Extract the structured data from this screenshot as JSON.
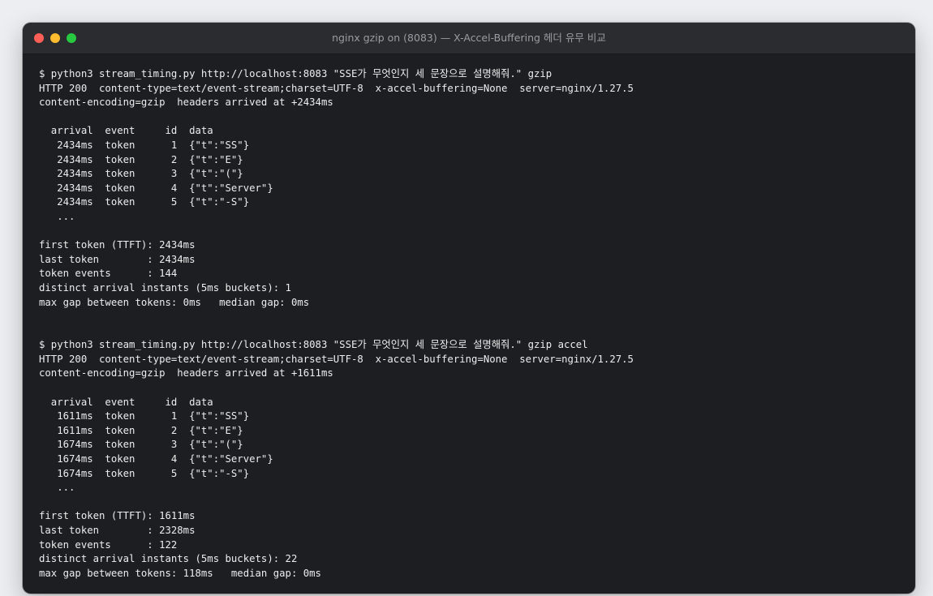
{
  "window": {
    "title": "nginx gzip on (8083) — X-Accel-Buffering 헤더 유무 비교",
    "colors": {
      "close": "#ff5f57",
      "minimize": "#febc2e",
      "maximize": "#28c840",
      "background": "#1d1e22",
      "text": "#ededed"
    }
  },
  "terminal": {
    "lines": [
      "$ python3 stream_timing.py http://localhost:8083 \"SSE가 무엇인지 세 문장으로 설명해줘.\" gzip",
      "HTTP 200  content-type=text/event-stream;charset=UTF-8  x-accel-buffering=None  server=nginx/1.27.5",
      "content-encoding=gzip  headers arrived at +2434ms",
      "",
      "  arrival  event     id  data",
      "   2434ms  token      1  {\"t\":\"SS\"}",
      "   2434ms  token      2  {\"t\":\"E\"}",
      "   2434ms  token      3  {\"t\":\"(\"}",
      "   2434ms  token      4  {\"t\":\"Server\"}",
      "   2434ms  token      5  {\"t\":\"-S\"}",
      "   ...",
      "",
      "first token (TTFT): 2434ms",
      "last token        : 2434ms",
      "token events      : 144",
      "distinct arrival instants (5ms buckets): 1",
      "max gap between tokens: 0ms   median gap: 0ms",
      "",
      "",
      "$ python3 stream_timing.py http://localhost:8083 \"SSE가 무엇인지 세 문장으로 설명해줘.\" gzip accel",
      "HTTP 200  content-type=text/event-stream;charset=UTF-8  x-accel-buffering=None  server=nginx/1.27.5",
      "content-encoding=gzip  headers arrived at +1611ms",
      "",
      "  arrival  event     id  data",
      "   1611ms  token      1  {\"t\":\"SS\"}",
      "   1611ms  token      2  {\"t\":\"E\"}",
      "   1674ms  token      3  {\"t\":\"(\"}",
      "   1674ms  token      4  {\"t\":\"Server\"}",
      "   1674ms  token      5  {\"t\":\"-S\"}",
      "   ...",
      "",
      "first token (TTFT): 1611ms",
      "last token        : 2328ms",
      "token events      : 122",
      "distinct arrival instants (5ms buckets): 22",
      "max gap between tokens: 118ms   median gap: 0ms"
    ]
  }
}
